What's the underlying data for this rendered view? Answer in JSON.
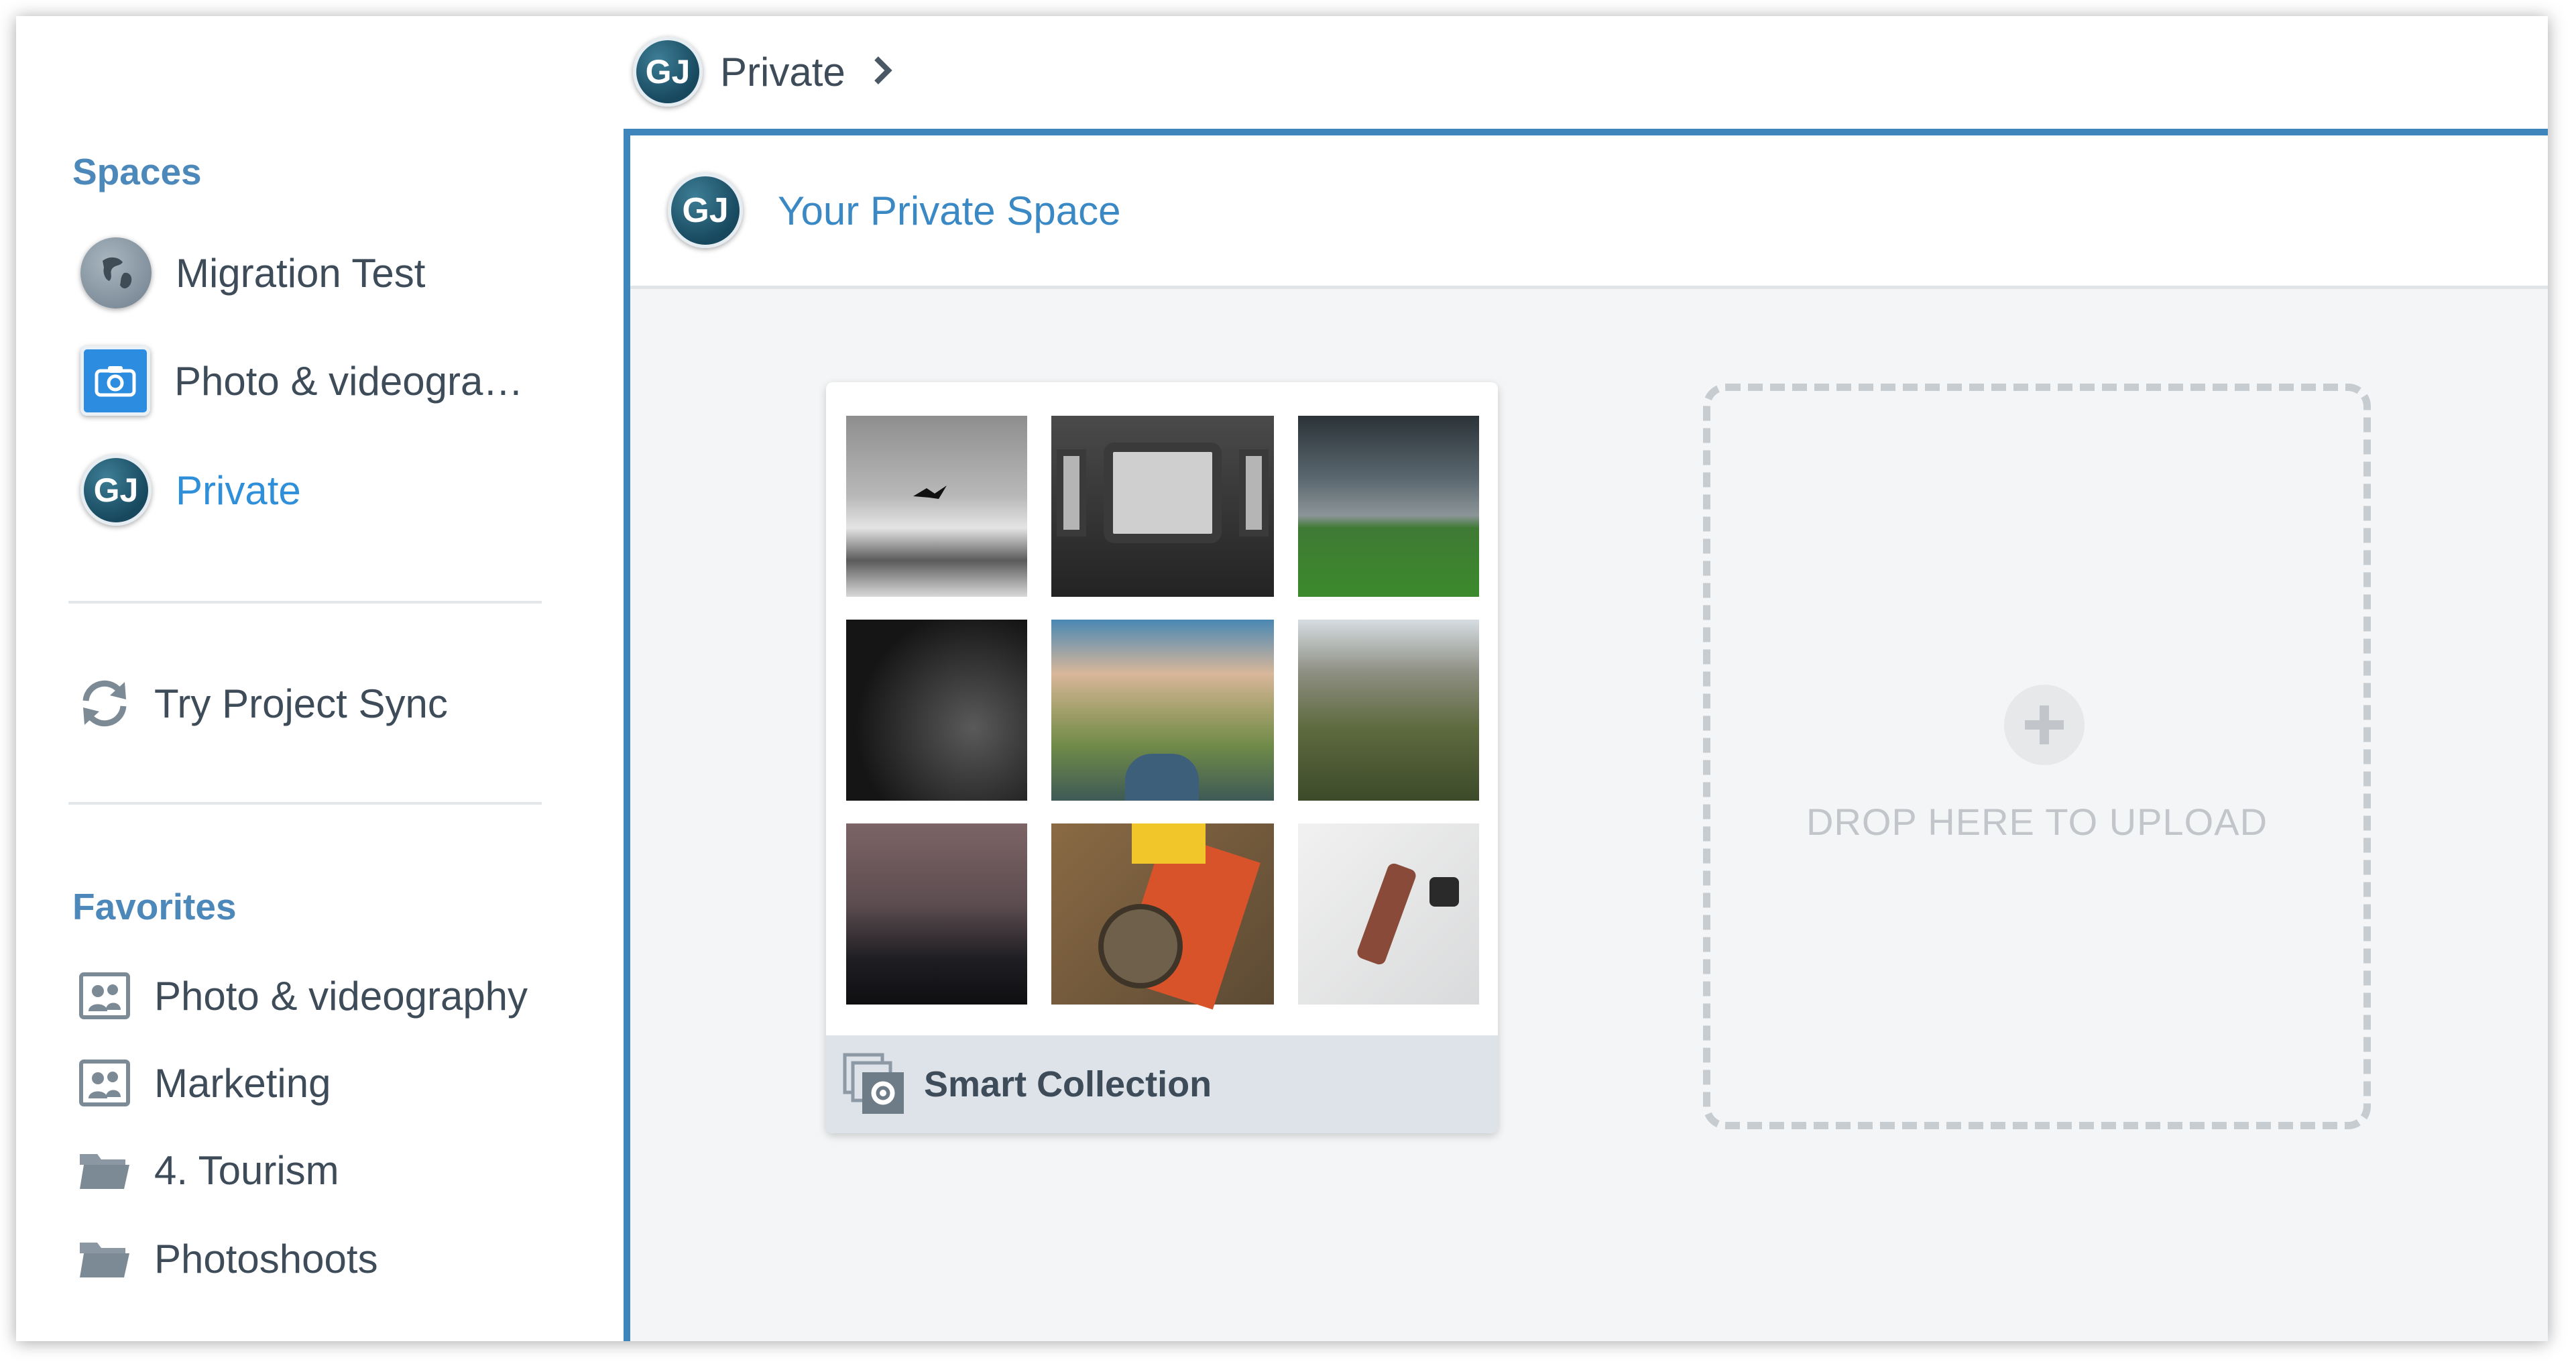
{
  "breadcrumb": {
    "avatar": "GJ",
    "label": "Private",
    "chevron": "chevron-right-icon"
  },
  "sidebar": {
    "spaces_title": "Spaces",
    "spaces": [
      {
        "label": "Migration Test",
        "icon": "globe-icon"
      },
      {
        "label": "Photo & videogra…",
        "icon": "camera-icon"
      },
      {
        "label": "Private",
        "icon": "GJ",
        "active": true
      }
    ],
    "project_sync": {
      "label": "Try Project Sync",
      "icon": "sync-icon"
    },
    "favorites_title": "Favorites",
    "favorites": [
      {
        "label": "Photo & videography",
        "icon": "people-collection-icon"
      },
      {
        "label": "Marketing",
        "icon": "people-collection-icon"
      },
      {
        "label": "4. Tourism",
        "icon": "folder-icon"
      },
      {
        "label": "Photoshoots",
        "icon": "folder-icon"
      }
    ]
  },
  "main": {
    "header": {
      "avatar": "GJ",
      "title": "Your Private Space"
    },
    "collection": {
      "label": "Smart Collection",
      "icon": "smart-collection-icon",
      "thumbnails": [
        "mountain-bird",
        "train-window",
        "storm-field",
        "underwater-dark",
        "road-hills",
        "mountain-valley",
        "bridge-dusk",
        "field-notes",
        "white-flatlay"
      ]
    },
    "dropzone": {
      "text": "DROP HERE TO UPLOAD",
      "icon": "plus-icon"
    }
  },
  "colors": {
    "accent": "#3e85bb",
    "link": "#3a89c4",
    "active": "#2f8fd8",
    "section": "#4c88b9",
    "text": "#3e4c5a"
  }
}
